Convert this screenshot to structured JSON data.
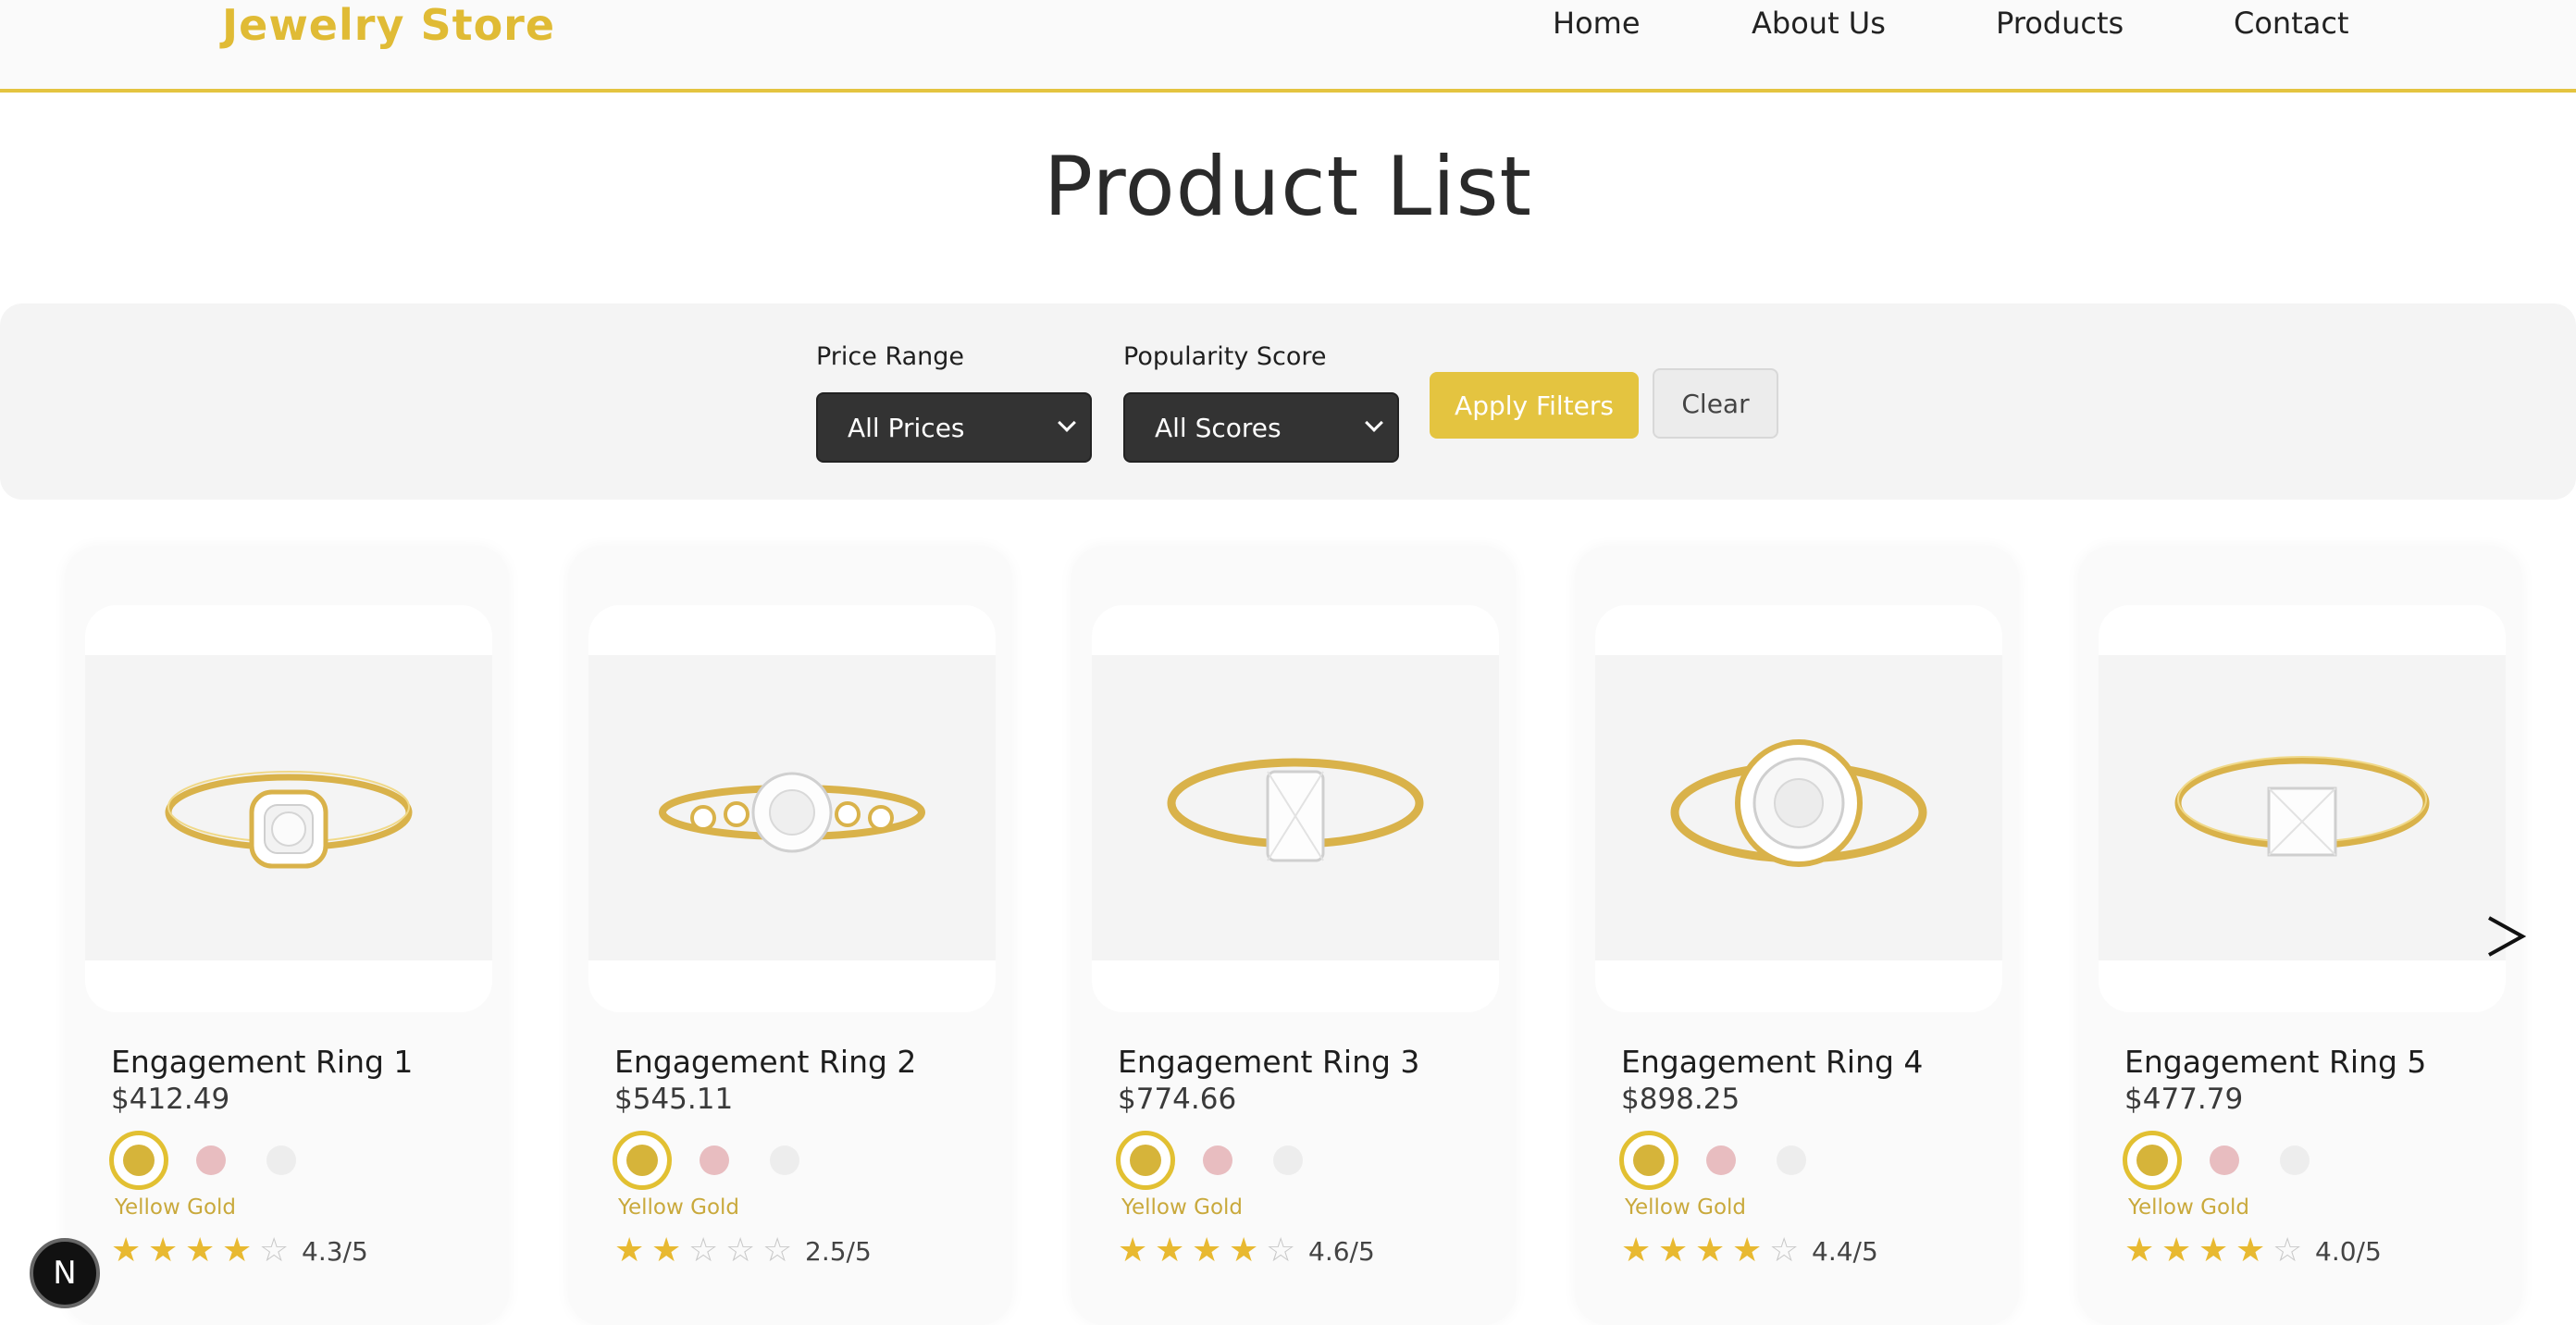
{
  "header": {
    "brand": "Jewelry Store",
    "nav": [
      "Home",
      "About Us",
      "Products",
      "Contact"
    ]
  },
  "page": {
    "title": "Product List"
  },
  "filters": {
    "price_label": "Price Range",
    "price_value": "All Prices",
    "score_label": "Popularity Score",
    "score_value": "All Scores",
    "apply_label": "Apply Filters",
    "clear_label": "Clear"
  },
  "products": [
    {
      "name": "Engagement Ring 1",
      "price": "$412.49",
      "metal": "Yellow Gold",
      "rating": 4.3,
      "rating_text": "4.3/5",
      "stars": [
        1,
        1,
        1,
        1,
        0
      ]
    },
    {
      "name": "Engagement Ring 2",
      "price": "$545.11",
      "metal": "Yellow Gold",
      "rating": 2.5,
      "rating_text": "2.5/5",
      "stars": [
        1,
        1,
        0,
        0,
        0
      ]
    },
    {
      "name": "Engagement Ring 3",
      "price": "$774.66",
      "metal": "Yellow Gold",
      "rating": 4.6,
      "rating_text": "4.6/5",
      "stars": [
        1,
        1,
        1,
        1,
        0
      ]
    },
    {
      "name": "Engagement Ring 4",
      "price": "$898.25",
      "metal": "Yellow Gold",
      "rating": 4.4,
      "rating_text": "4.4/5",
      "stars": [
        1,
        1,
        1,
        1,
        0
      ]
    },
    {
      "name": "Engagement Ring 5",
      "price": "$477.79",
      "metal": "Yellow Gold",
      "rating": 4.0,
      "rating_text": "4.0/5",
      "stars": [
        1,
        1,
        1,
        1,
        0
      ]
    }
  ],
  "icons": {
    "next": "chevron-right-icon",
    "badge": "N"
  },
  "colors": {
    "accent": "#e4c440",
    "select_bg": "#333333",
    "star_on": "#e8b931",
    "rose": "#e8bdc0",
    "white_gold": "#ededed",
    "yellow_gold": "#d6b43a"
  }
}
